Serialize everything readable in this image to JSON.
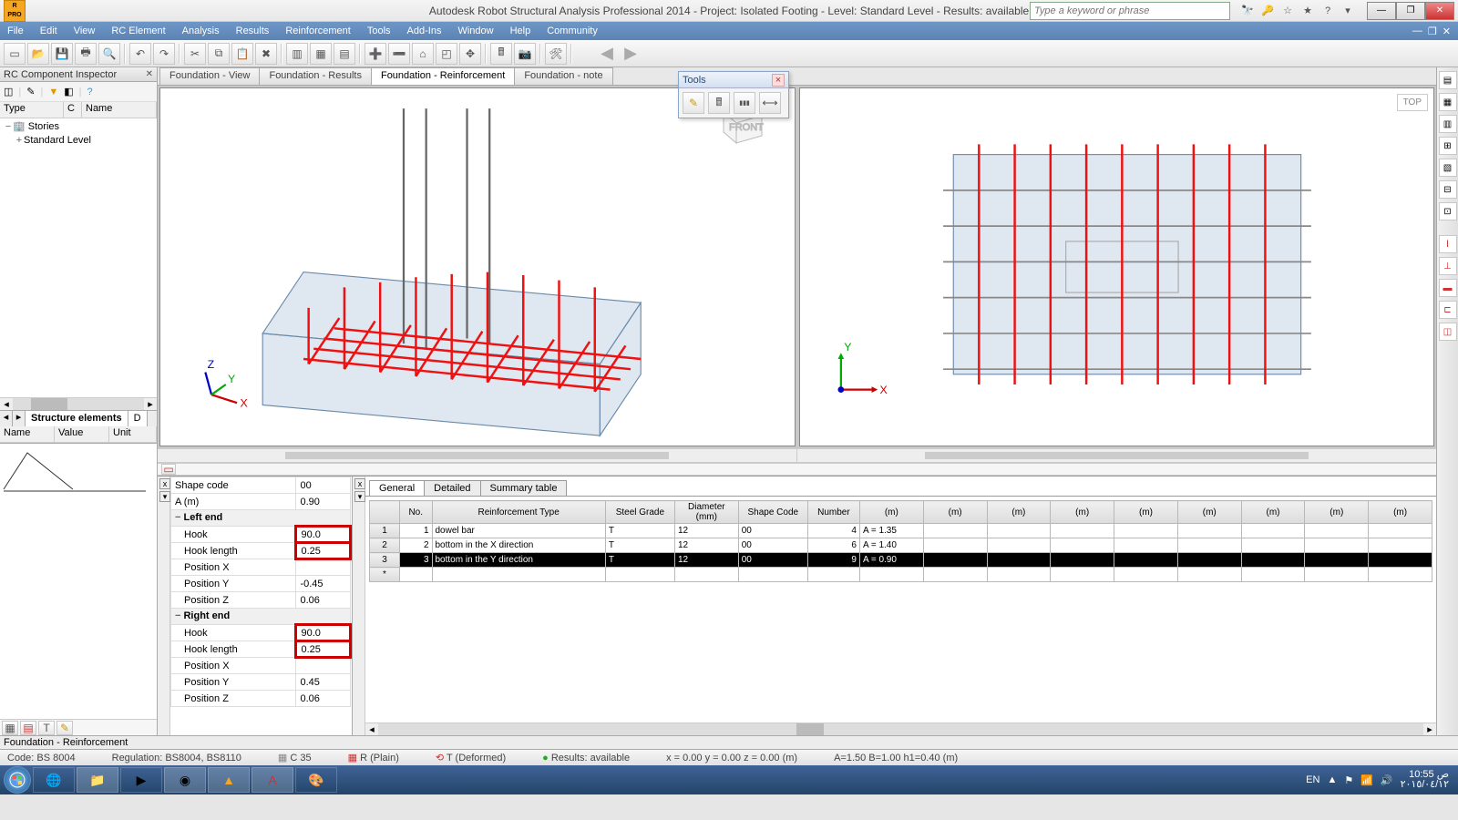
{
  "window": {
    "title": "Autodesk Robot Structural Analysis Professional 2014 - Project: Isolated Footing - Level: Standard Level - Results: available",
    "search_placeholder": "Type a keyword or phrase"
  },
  "menu": [
    "File",
    "Edit",
    "View",
    "RC Element",
    "Analysis",
    "Results",
    "Reinforcement",
    "Tools",
    "Add-Ins",
    "Window",
    "Help",
    "Community"
  ],
  "inspector": {
    "title": "RC Component Inspector",
    "columns": [
      "Type",
      "C",
      "Name"
    ],
    "root": "Stories",
    "child": "Standard Level",
    "tabs": [
      "Structure elements",
      "D"
    ],
    "propcols": [
      "Name",
      "Value",
      "Unit"
    ]
  },
  "doc_tabs": [
    "Foundation - View",
    "Foundation - Results",
    "Foundation - Reinforcement",
    "Foundation - note"
  ],
  "active_doc_tab": 2,
  "float": {
    "title": "Tools"
  },
  "viewport_left": {
    "label_front": "FRONT"
  },
  "viewport_right": {
    "label_top": "TOP"
  },
  "props": {
    "shape_code_label": "Shape code",
    "shape_code": "00",
    "a_label": "A (m)",
    "a": "0.90",
    "left_end": "Left end",
    "hook_label": "Hook",
    "left_hook": "90.0",
    "hooklen_label": "Hook length",
    "left_hooklen": "0.25",
    "posx_label": "Position X",
    "left_posx": "",
    "posy_label": "Position Y",
    "left_posy": "-0.45",
    "posz_label": "Position Z",
    "left_posz": "0.06",
    "right_end": "Right end",
    "right_hook": "90.0",
    "right_hooklen": "0.25",
    "right_posx": "",
    "right_posy": "0.45",
    "right_posz": "0.06"
  },
  "subtabs": [
    "General",
    "Detailed",
    "Summary table"
  ],
  "grid": {
    "cols": [
      "",
      "No.",
      "Reinforcement Type",
      "Steel Grade",
      "Diameter (mm)",
      "Shape Code",
      "Number",
      "(m)",
      "(m)",
      "(m)",
      "(m)",
      "(m)",
      "(m)",
      "(m)",
      "(m)",
      "(m)"
    ],
    "rows": [
      {
        "rn": "1",
        "no": "1",
        "type": "dowel bar",
        "grade": "T",
        "dia": "12",
        "sc": "00",
        "num": "4",
        "m1": "A = 1.35"
      },
      {
        "rn": "2",
        "no": "2",
        "type": "bottom in the X direction",
        "grade": "T",
        "dia": "12",
        "sc": "00",
        "num": "6",
        "m1": "A = 1.40"
      },
      {
        "rn": "3",
        "no": "3",
        "type": "bottom in the Y direction",
        "grade": "T",
        "dia": "12",
        "sc": "00",
        "num": "9",
        "m1": "A = 0.90"
      }
    ],
    "star": "*"
  },
  "status1": "Foundation - Reinforcement",
  "status2": {
    "code": "Code: BS 8004",
    "reg": "Regulation: BS8004, BS8110",
    "c35": "C 35",
    "rplain": "R (Plain)",
    "tdef": "T (Deformed)",
    "res": "Results: available",
    "coord": "x = 0.00 y = 0.00 z = 0.00   (m)",
    "dims": "A=1.50 B=1.00 h1=0.40 (m)"
  },
  "tray": {
    "lang": "EN",
    "time": "10:55",
    "ampm": "ص",
    "date": "٢٠١٥/٠٤/١٢"
  }
}
